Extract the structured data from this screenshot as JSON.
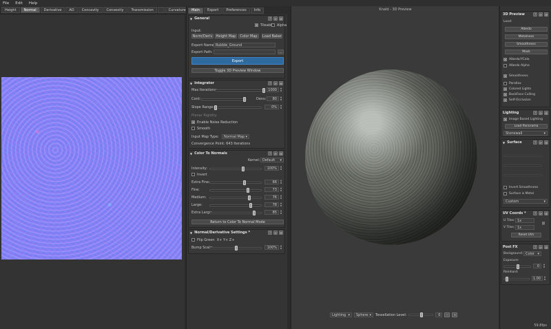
{
  "menu": [
    "File",
    "Edit",
    "Help"
  ],
  "left_tabs": [
    "Height",
    "Normal",
    "Derivative",
    "AO",
    "Concavity",
    "Convexity",
    "Transmission",
    "",
    "Curvature"
  ],
  "left_active_tab": "Normal",
  "mid_tabs": [
    "Main",
    "Export",
    "Preferences",
    "Info"
  ],
  "general": {
    "title": "General",
    "tileable": "Tileable",
    "alpha": "Alpha",
    "input_label": "Input:",
    "input_buttons": [
      "Norm/Deriv",
      "Height Map",
      "Color Map",
      "Load Baker"
    ],
    "export_name_label": "Export Name:",
    "export_name_value": "Rubble_Ground",
    "export_path_label": "Export Path:",
    "export_path_value": "",
    "browse": "...",
    "export_button": "Export",
    "toggle_button": "Toggle 3D Preview Window"
  },
  "integrator": {
    "title": "Integrator",
    "max_iterations_label": "Max Iterations:",
    "max_iterations_value": "1000",
    "cont_label": "Cont:",
    "dens_label": "Dens:",
    "dens_value": "80",
    "slope_range_label": "Slope Range:",
    "slope_range_value": "0%",
    "planar_rigidity_label": "Planar Rigidity:",
    "enable_noise_reduction": "Enable Noise Reduction",
    "smooth": "Smooth",
    "input_map_type_label": "Input Map Type:",
    "input_map_type_value": "Normal Map",
    "convergence_label": "Convergence Point:",
    "convergence_value": "643 Iterations"
  },
  "color_to_normals": {
    "title": "Color To Normals",
    "kernel_label": "Kernel:",
    "kernel_value": "Default",
    "intensity_label": "Intensity:",
    "intensity_value": "100%",
    "invert": "Invert",
    "extra_fine_label": "Extra Fine:",
    "extra_fine_value": "66",
    "fine_label": "Fine:",
    "fine_value": "73",
    "medium_label": "Medium:",
    "medium_value": "76",
    "large_label": "Large:",
    "large_value": "78",
    "extra_large_label": "Extra Large:",
    "extra_large_value": "85",
    "return_button": "Return to Color To Normal Mode"
  },
  "normal_derivative": {
    "title": "Normal/Derivative Settings *",
    "flip_green": "Flip Green",
    "flip_green_hint": "X+ Y+ Z+",
    "bump_scale_label": "Bump Scale:",
    "bump_scale_value": "100%"
  },
  "viewport": {
    "title": "Knald - 3D Preview",
    "lighting_select": "Lighting",
    "shape_select": "Sphere",
    "tessellation_label": "Tessellation Level:",
    "tessellation_value": "0",
    "fps": "59.8fps"
  },
  "preview3d": {
    "title": "3D Preview",
    "load_label": "Load:",
    "buttons": [
      "Albedo",
      "Metalness",
      "Smoothness",
      "Mask"
    ],
    "albedo_ycolo": "Albedo/YColo",
    "albedo_alpha": "Albedo Alpha",
    "smoothness": "Smoothness",
    "parallax": "Parallax",
    "colored_lights": "Colored Lights",
    "backface_culling": "BackFace Culling",
    "self_occlusion": "Self-Occlusion"
  },
  "lighting": {
    "title": "Lighting",
    "image_based": "Image Based Lighting",
    "load_panorama": "Load Panorama",
    "panorama_value": "Stonewall"
  },
  "surface": {
    "title": "Surface",
    "invert_smoothness": "Invert Smoothness",
    "surface_is_metal": "Surface is Metal",
    "preset_value": "Custom"
  },
  "uv_coords": {
    "title": "UV Coords *",
    "u_tiles_label": "U Tiles:",
    "u_tiles_value": "1x",
    "v_tiles_label": "V Tiles:",
    "v_tiles_value": "1x",
    "reset_button": "Reset UVs"
  },
  "post_fx": {
    "title": "Post FX",
    "background_label": "Background:",
    "background_value": "Color",
    "exposure_label": "Exposure:",
    "exposure_value": "0",
    "reinhard_label": "Reinhard:",
    "reinhard_value": "1.00"
  }
}
